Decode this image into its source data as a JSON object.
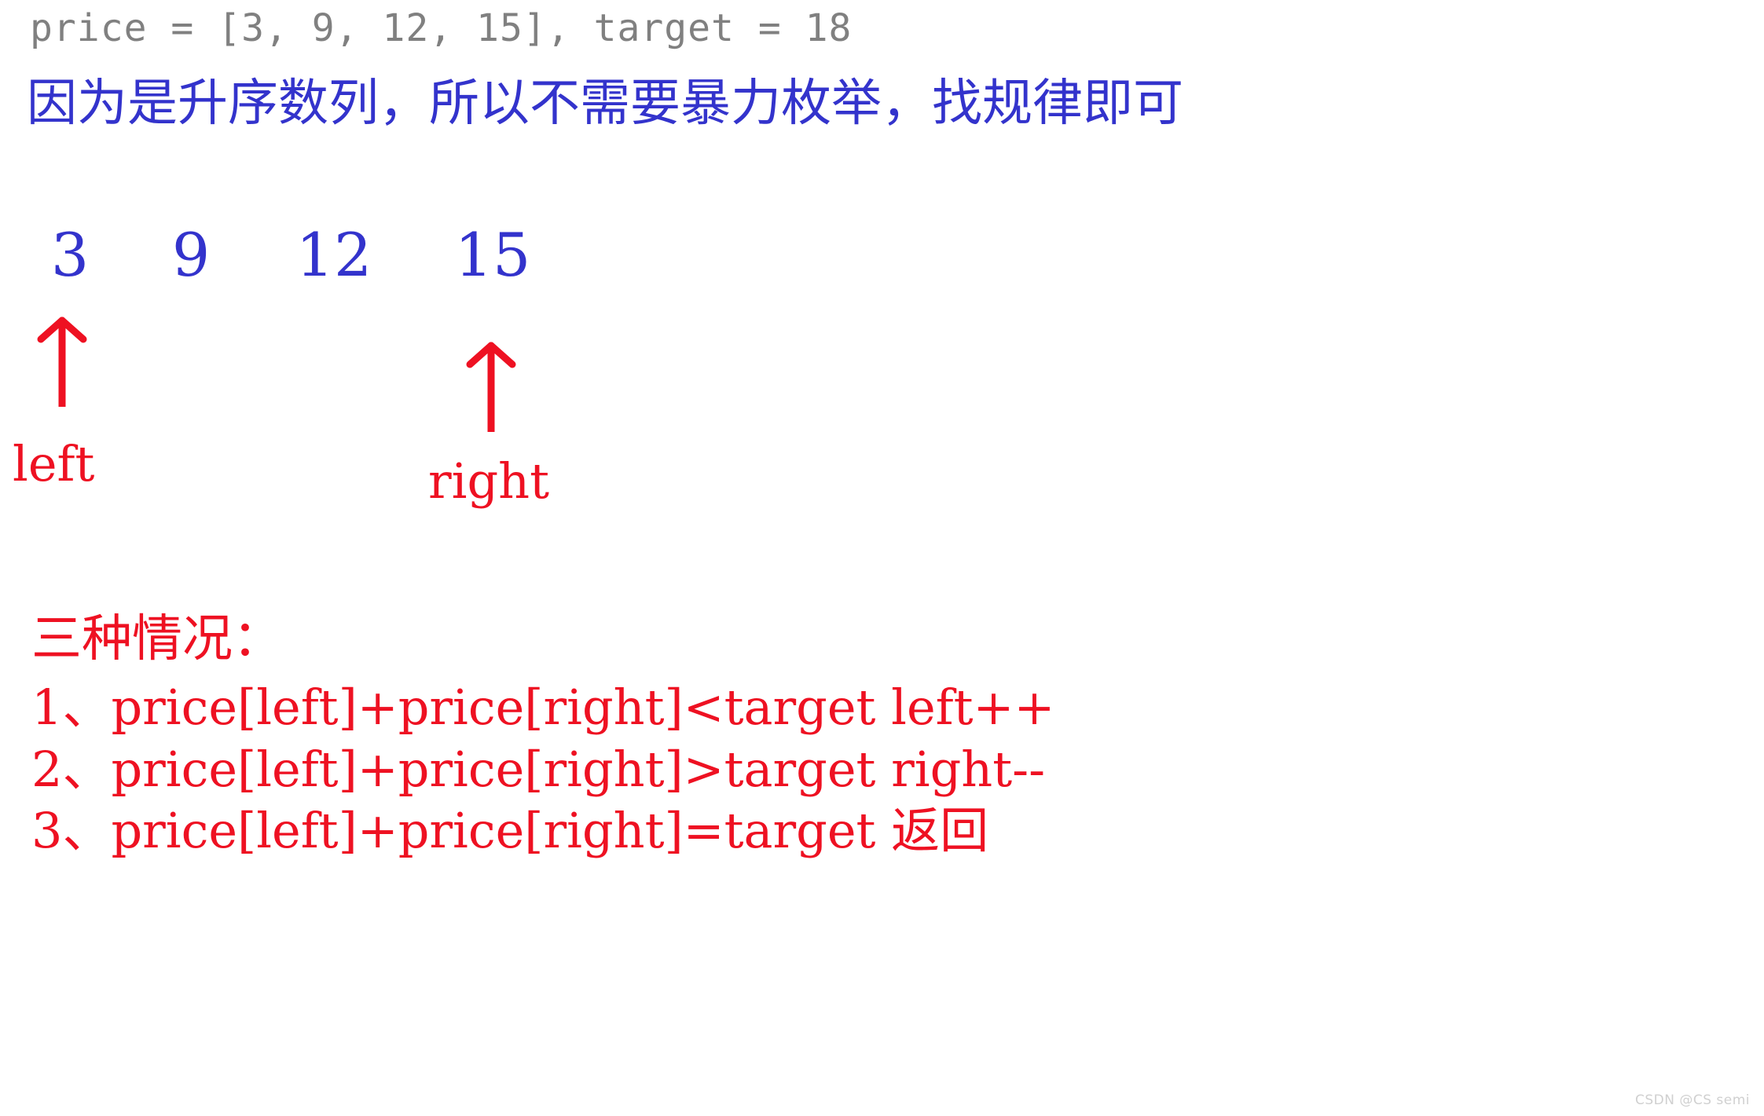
{
  "header": {
    "code_line": "price = [3, 9, 12, 15], target = 18"
  },
  "note": {
    "text": "因为是升序数列，所以不需要暴力枚举，找规律即可"
  },
  "array": {
    "values": [
      "3",
      "9",
      "12",
      "15"
    ],
    "pointers": {
      "left_label": "left",
      "right_label": "right"
    }
  },
  "cases": {
    "title": "三种情况：",
    "items": [
      "1、price[left]+price[right]<target left++",
      "2、price[left]+price[right]>target right--",
      "3、price[left]+price[right]=target 返回"
    ]
  },
  "watermark": {
    "text": "CSDN @CS semi"
  },
  "colors": {
    "code_gray": "#808080",
    "note_blue": "#3333cc",
    "number_blue": "#3333cc",
    "accent_red": "#ee1122",
    "background": "#ffffff",
    "watermark_gray": "#d0d0d0"
  },
  "icons": {
    "up_arrow": "up-arrow-icon"
  }
}
